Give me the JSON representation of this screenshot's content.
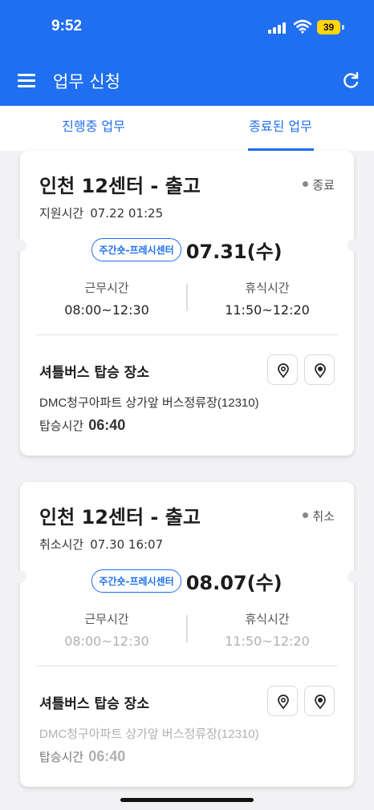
{
  "status_bar": {
    "time": "9:52",
    "battery": "39"
  },
  "header": {
    "title": "업무 신청"
  },
  "tabs": [
    {
      "label": "진행중 업무",
      "active": false
    },
    {
      "label": "종료된 업무",
      "active": true
    }
  ],
  "cards": [
    {
      "title": "인천 12센터 - 출고",
      "status": "종료",
      "sub_label": "지원시간",
      "sub_value": "07.22 01:25",
      "badge": "주간숏-프레시센터",
      "date": "07.31(수)",
      "work_label": "근무시간",
      "work_time": "08:00~12:30",
      "break_label": "휴식시간",
      "break_time": "11:50~12:20",
      "shuttle_label": "셔틀버스 탑승 장소",
      "address": "DMC청구아파트 상가앞 버스정류장(12310)",
      "boarding_label": "탑승시간",
      "boarding_time": "06:40"
    },
    {
      "title": "인천 12센터 - 출고",
      "status": "취소",
      "sub_label": "취소시간",
      "sub_value": "07.30 16:07",
      "badge": "주간숏-프레시센터",
      "date": "08.07(수)",
      "work_label": "근무시간",
      "work_time": "08:00~12:30",
      "break_label": "휴식시간",
      "break_time": "11:50~12:20",
      "shuttle_label": "셔틀버스 탑승 장소",
      "address": "DMC청구아파트 상가앞 버스정류장(12310)",
      "boarding_label": "탑승시간",
      "boarding_time": "06:40"
    }
  ],
  "colors": {
    "primary": "#1f6ff0",
    "background": "#f2f2f4",
    "faded": "#b0b0b5"
  }
}
